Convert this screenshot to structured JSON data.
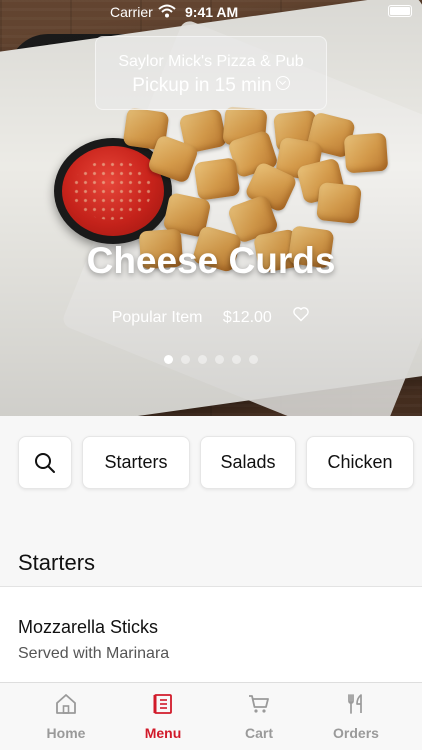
{
  "status_bar": {
    "carrier": "Carrier",
    "time": "9:41 AM"
  },
  "store": {
    "name": "Saylor Mick's Pizza & Pub",
    "pickup": "Pickup in 15 min"
  },
  "featured": {
    "title": "Cheese Curds",
    "tag": "Popular Item",
    "price": "$12.00",
    "page_count": 6,
    "active_page": 1
  },
  "categories": [
    "Starters",
    "Salads",
    "Chicken"
  ],
  "section": {
    "title": "Starters"
  },
  "menu_items": [
    {
      "name": "Mozzarella Sticks",
      "description": "Served with Marinara"
    }
  ],
  "tabs": [
    {
      "label": "Home",
      "icon": "home-icon"
    },
    {
      "label": "Menu",
      "icon": "menu-icon"
    },
    {
      "label": "Cart",
      "icon": "cart-icon"
    },
    {
      "label": "Orders",
      "icon": "utensils-icon"
    }
  ],
  "colors": {
    "accent": "#d11a2a",
    "inactive": "#9a9a9a"
  }
}
